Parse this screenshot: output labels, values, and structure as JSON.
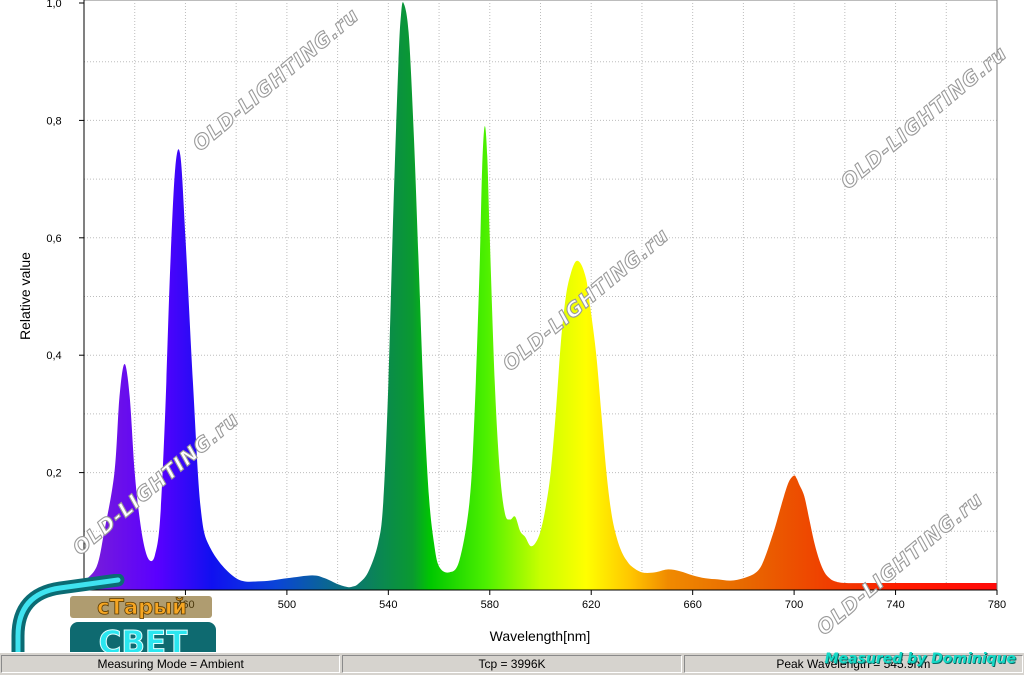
{
  "chart_data": {
    "type": "area",
    "title": "",
    "xlabel": "Wavelength[nm]",
    "ylabel": "Relative value",
    "xlim": [
      420,
      780
    ],
    "ylim": [
      0,
      1.0
    ],
    "x_ticks": [
      460,
      500,
      540,
      580,
      620,
      660,
      700,
      740,
      780
    ],
    "x_tick_labels": [
      "460",
      "500",
      "540",
      "580",
      "620",
      "660",
      "700",
      "740",
      "780"
    ],
    "y_ticks": [
      0,
      0.2,
      0.4,
      0.6,
      0.8,
      1.0
    ],
    "y_tick_labels": [
      "0",
      "0,2",
      "0,4",
      "0,6",
      "0,8",
      "1,0"
    ],
    "grid": true,
    "fill": "spectral-rainbow",
    "series": [
      {
        "x": [
          420,
          425,
          428,
          432,
          434,
          436,
          438,
          440,
          442,
          444,
          446,
          448,
          450,
          452,
          454,
          456,
          458,
          460,
          463,
          466,
          470,
          480,
          490,
          500,
          510,
          515,
          520,
          524,
          526,
          528,
          532,
          536,
          538,
          540,
          542,
          544,
          545,
          546,
          548,
          550,
          552,
          554,
          556,
          558,
          560,
          564,
          568,
          572,
          574,
          576,
          577,
          578,
          579,
          580,
          582,
          584,
          586,
          588,
          590,
          592,
          594,
          596,
          598,
          600,
          602,
          604,
          606,
          608,
          610,
          612,
          614,
          616,
          618,
          619,
          620,
          622,
          624,
          626,
          628,
          630,
          632,
          634,
          636,
          640,
          645,
          650,
          655,
          660,
          665,
          670,
          675,
          680,
          685,
          688,
          692,
          694,
          696,
          698,
          700,
          701,
          702,
          704,
          706,
          708,
          710,
          712,
          714,
          716,
          720,
          730,
          740,
          750,
          760,
          770,
          780
        ],
        "y": [
          0.015,
          0.04,
          0.1,
          0.2,
          0.33,
          0.385,
          0.33,
          0.2,
          0.12,
          0.07,
          0.05,
          0.06,
          0.12,
          0.3,
          0.55,
          0.72,
          0.74,
          0.6,
          0.35,
          0.14,
          0.07,
          0.02,
          0.015,
          0.02,
          0.025,
          0.02,
          0.01,
          0.005,
          0.006,
          0.01,
          0.03,
          0.08,
          0.15,
          0.35,
          0.65,
          0.9,
          0.98,
          1.0,
          0.95,
          0.78,
          0.55,
          0.32,
          0.16,
          0.08,
          0.04,
          0.03,
          0.05,
          0.15,
          0.3,
          0.55,
          0.72,
          0.79,
          0.74,
          0.6,
          0.35,
          0.2,
          0.13,
          0.12,
          0.125,
          0.1,
          0.09,
          0.075,
          0.08,
          0.1,
          0.14,
          0.2,
          0.3,
          0.42,
          0.5,
          0.54,
          0.56,
          0.555,
          0.53,
          0.5,
          0.47,
          0.4,
          0.3,
          0.2,
          0.13,
          0.09,
          0.065,
          0.05,
          0.04,
          0.03,
          0.03,
          0.035,
          0.032,
          0.025,
          0.02,
          0.018,
          0.016,
          0.02,
          0.03,
          0.05,
          0.1,
          0.13,
          0.16,
          0.185,
          0.195,
          0.19,
          0.18,
          0.16,
          0.12,
          0.08,
          0.05,
          0.03,
          0.02,
          0.015,
          0.012,
          0.012,
          0.012,
          0.012,
          0.012,
          0.012,
          0.012
        ]
      }
    ]
  },
  "watermarks": [
    "OLD-LIGHTING.ru",
    "OLD-LIGHTING.ru",
    "OLD-LIGHTING.ru",
    "OLD-LIGHTING.ru",
    "OLD-LIGHTING.ru",
    "OLD-LIGHTING.ru"
  ],
  "status_bar": {
    "measuring_mode": "Measuring Mode = Ambient",
    "tcp": "Tcp = 3996K",
    "peak_wavelength": "Peak Wavelength = 545.9nm"
  },
  "credit": "Measured by Dominique",
  "logo": {
    "line1": "сТарый",
    "line2": "СВЕТ"
  }
}
